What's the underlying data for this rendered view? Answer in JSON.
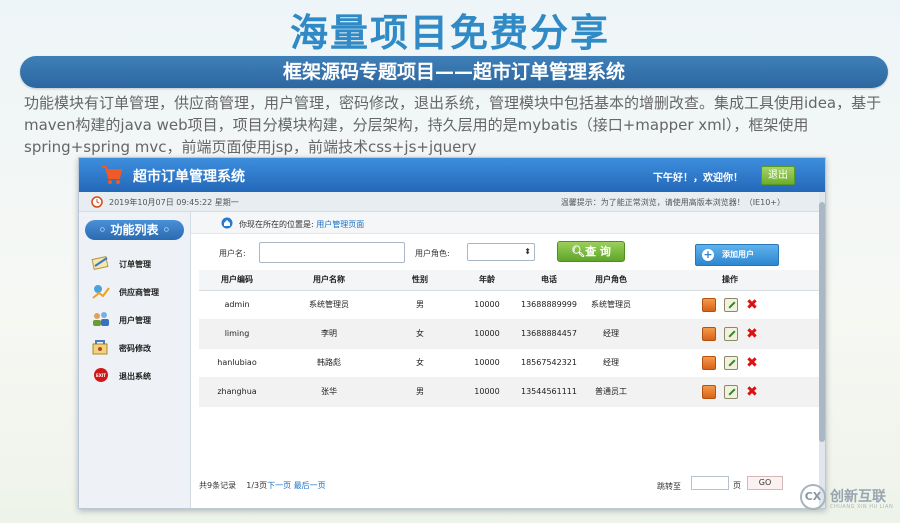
{
  "slide": {
    "title": "海量项目免费分享",
    "banner": "框架源码专题项目——超市订单管理系统",
    "description": "功能模块有订单管理，供应商管理，用户管理，密码修改，退出系统，管理模块中包括基本的增删改查。集成工具使用idea，基于maven构建的java web项目，项目分模块构建，分层架构，持久层用的是mybatis（接口+mapper xml），框架使用spring+spring mvc，前端页面使用jsp，前端技术css+js+jquery"
  },
  "app": {
    "title": "超市订单管理系统",
    "greeting": "下午好！，欢迎你！",
    "logout_label": "退出",
    "datetime": "2019年10月07日 09:45:22 星期一",
    "tip": "温馨提示：为了能正常浏览，请使用高版本浏览器！（IE10+）"
  },
  "sidebar": {
    "header": "◦ 功能列表 ◦",
    "items": [
      {
        "label": "订单管理",
        "icon": "order-icon"
      },
      {
        "label": "供应商管理",
        "icon": "supplier-icon"
      },
      {
        "label": "用户管理",
        "icon": "users-icon"
      },
      {
        "label": "密码修改",
        "icon": "password-icon"
      },
      {
        "label": "退出系统",
        "icon": "exit-icon"
      }
    ]
  },
  "breadcrumb": {
    "prefix": "你现在所在的位置是: ",
    "current": "用户管理页面"
  },
  "search": {
    "username_label": "用户名:",
    "username_value": "",
    "role_label": "用户角色:",
    "role_value": "",
    "query_label": "查 询",
    "add_label": "添加用户"
  },
  "table": {
    "headers": [
      "用户编码",
      "用户名称",
      "性别",
      "年龄",
      "电话",
      "用户角色",
      "操作"
    ],
    "rows": [
      [
        "admin",
        "系统管理员",
        "男",
        "10000",
        "13688889999",
        "系统管理员"
      ],
      [
        "liming",
        "李明",
        "女",
        "10000",
        "13688884457",
        "经理"
      ],
      [
        "hanlubiao",
        "韩路彪",
        "女",
        "10000",
        "18567542321",
        "经理"
      ],
      [
        "zhanghua",
        "张华",
        "男",
        "10000",
        "13544561111",
        "普通员工"
      ]
    ]
  },
  "pager": {
    "total": "共9条记录",
    "page": "1/3页",
    "next": "下一页",
    "last": "最后一页",
    "jump_label": "跳转至",
    "jump_value": "",
    "page_unit": "页",
    "go_label": "GO"
  },
  "brand": {
    "logo": "CX",
    "name": "创新互联",
    "sub": "CHUANG XIN HU LIAN"
  },
  "colors": {
    "title_blue": "#2f8ac6",
    "header_blue": "#2468b8",
    "green": "#6cae2d",
    "delete_red": "#dd1111"
  }
}
